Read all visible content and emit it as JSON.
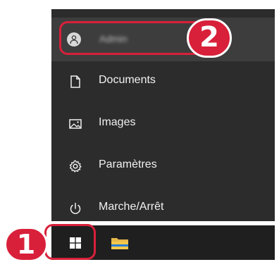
{
  "colors": {
    "menu_bg": "#2c2c2c",
    "menu_hover": "#3d3d3d",
    "taskbar_bg": "#1f1f1f",
    "highlight": "#d8203a",
    "text": "#f2f2f2"
  },
  "user": {
    "name": "Admin",
    "icon": "person-icon"
  },
  "menu": {
    "items": [
      {
        "label": "Documents",
        "icon": "document-icon"
      },
      {
        "label": "Images",
        "icon": "image-icon"
      },
      {
        "label": "Paramètres",
        "icon": "gear-icon"
      },
      {
        "label": "Marche/Arrêt",
        "icon": "power-icon"
      }
    ]
  },
  "taskbar": {
    "start_icon": "windows-logo-icon",
    "explorer_icon": "folder-icon"
  },
  "annotations": {
    "step1": "1",
    "step2": "2"
  }
}
